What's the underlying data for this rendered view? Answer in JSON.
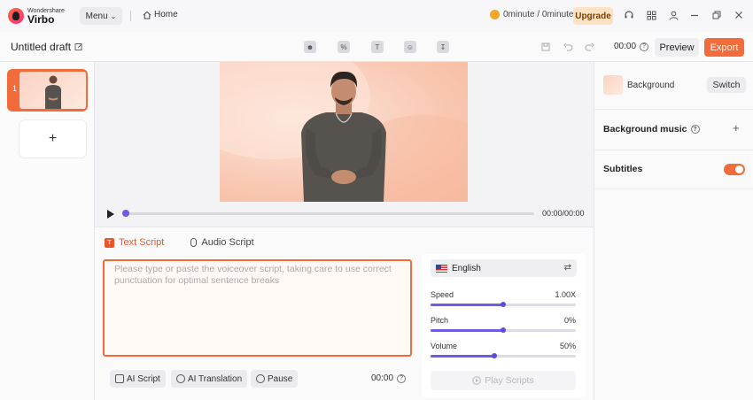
{
  "app": {
    "logo_small": "Wondershare",
    "logo_big": "Virbo"
  },
  "topbar": {
    "menu_label": "Menu",
    "home_label": "Home",
    "credits": "0minute / 0minute",
    "upgrade_label": "Upgrade"
  },
  "secondbar": {
    "draft_title": "Untitled draft",
    "time": "00:00",
    "preview_label": "Preview",
    "export_label": "Export"
  },
  "slides": [
    {
      "number": "1"
    }
  ],
  "player": {
    "timecode": "00:00/00:00",
    "progress": 0
  },
  "script": {
    "tabs": [
      {
        "label": "Text Script",
        "active": true
      },
      {
        "label": "Audio Script",
        "active": false
      }
    ],
    "placeholder": "Please type or paste the voiceover script, taking care to use correct punctuation for optimal sentence breaks",
    "tools": {
      "ai_script": "AI Script",
      "ai_translation": "AI Translation",
      "pause": "Pause"
    },
    "duration": "00:00"
  },
  "voice": {
    "language": "English",
    "sliders": [
      {
        "label": "Speed",
        "value": "1.00X",
        "fraction": 0.5
      },
      {
        "label": "Pitch",
        "value": "0%",
        "fraction": 0.5
      },
      {
        "label": "Volume",
        "value": "50%",
        "fraction": 0.44
      }
    ],
    "play_label": "Play Scripts"
  },
  "rightpanel": {
    "background_label": "Background",
    "switch_label": "Switch",
    "music_label": "Background music",
    "subtitles_label": "Subtitles",
    "subtitles_on": true
  },
  "colors": {
    "accent": "#f26b3a",
    "slider": "#6c5ce7"
  }
}
